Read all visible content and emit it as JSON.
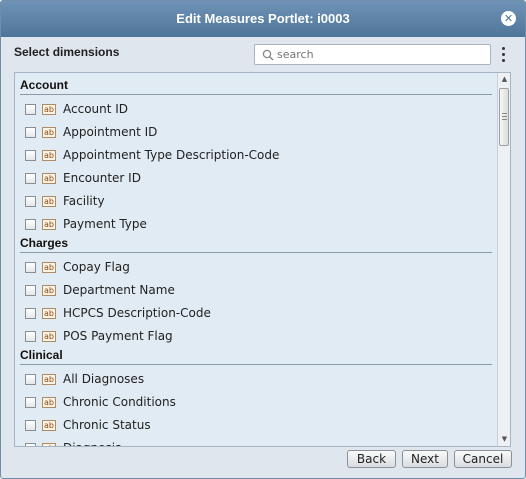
{
  "window": {
    "title": "Edit Measures Portlet: i0003",
    "close_glyph": "✕"
  },
  "heading": "Select dimensions",
  "search": {
    "placeholder": "search",
    "value": ""
  },
  "type_badge": "ab",
  "groups": [
    {
      "label": "Account",
      "items": [
        "Account ID",
        "Appointment ID",
        "Appointment Type Description-Code",
        "Encounter ID",
        "Facility",
        "Payment Type"
      ]
    },
    {
      "label": "Charges",
      "items": [
        "Copay Flag",
        "Department Name",
        "HCPCS Description-Code",
        "POS Payment Flag"
      ]
    },
    {
      "label": "Clinical",
      "items": [
        "All Diagnoses",
        "Chronic Conditions",
        "Chronic Status",
        "Diagnosis"
      ]
    }
  ],
  "buttons": {
    "back": "Back",
    "next": "Next",
    "cancel": "Cancel"
  },
  "scroll": {
    "position_fraction": 0.0,
    "visible_fraction": 0.2
  },
  "colors": {
    "title_bar": "#5a81a6",
    "dialog_bg": "#dfe6ee",
    "list_bg": "#e1ebf3",
    "badge_text": "#8a4a12"
  }
}
